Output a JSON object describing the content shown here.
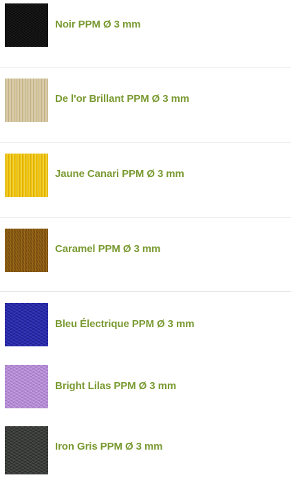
{
  "products": [
    {
      "title": "Noir PPM Ø 3 mm",
      "swatch_color": "#0a0a0a",
      "swatch_icon": "black-cord-swatch"
    },
    {
      "title": "De l'or Brillant PPM Ø 3 mm",
      "swatch_color": "#d9c9a0",
      "swatch_icon": "gold-cord-swatch"
    },
    {
      "title": "Jaune Canari PPM Ø 3 mm",
      "swatch_color": "#f2c40c",
      "swatch_icon": "yellow-cord-swatch"
    },
    {
      "title": "Caramel PPM Ø 3 mm",
      "swatch_color": "#8a5c14",
      "swatch_icon": "caramel-cord-swatch"
    },
    {
      "title": "Bleu Électrique PPM Ø 3 mm",
      "swatch_color": "#2a2aa8",
      "swatch_icon": "blue-cord-swatch"
    },
    {
      "title": "Bright Lilas PPM Ø 3 mm",
      "swatch_color": "#b48ad6",
      "swatch_icon": "lilac-cord-swatch"
    },
    {
      "title": "Iron Gris PPM Ø 3 mm",
      "swatch_color": "#3a3d3a",
      "swatch_icon": "iron-gray-cord-swatch"
    }
  ],
  "colors": {
    "title_text": "#7a9a32",
    "divider": "#e6e6e6",
    "background": "#ffffff"
  }
}
